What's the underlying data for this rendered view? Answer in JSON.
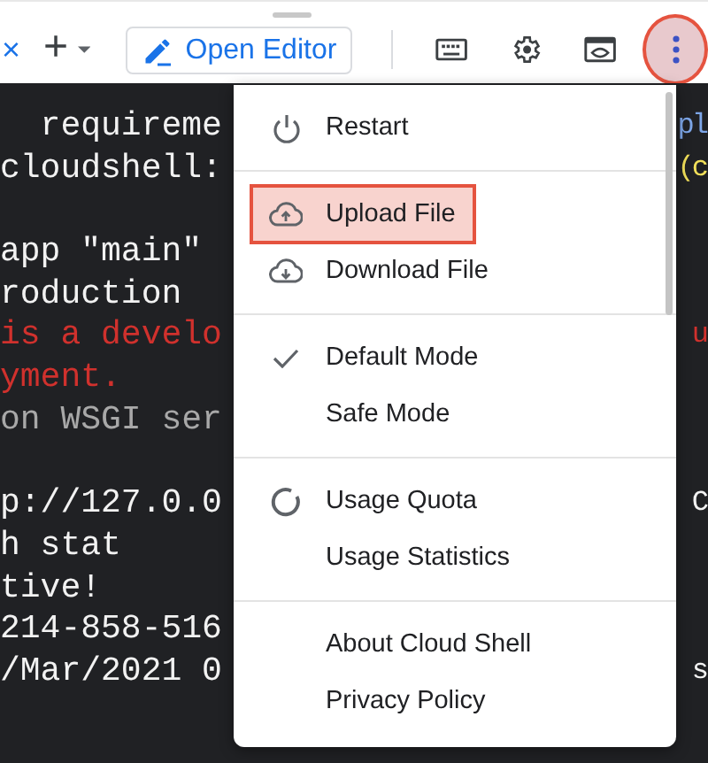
{
  "toolbar": {
    "tab_close": "×",
    "add": "+",
    "editor_button": "Open Editor",
    "more_highlighted": true
  },
  "terminal": [
    {
      "kind": "text",
      "text": "  requireme",
      "tail": {
        "text": "pl",
        "color": "#7da6e8"
      }
    },
    {
      "kind": "text",
      "text": "cloudshell:",
      "tail": {
        "text": "(c",
        "color": "#f2e05a"
      }
    },
    {
      "kind": "blank"
    },
    {
      "kind": "text",
      "text": "app \"main\""
    },
    {
      "kind": "text",
      "text": "roduction"
    },
    {
      "kind": "text",
      "text": "is a develo",
      "color": "#d0312d",
      "tail": {
        "text": "u",
        "color": "#d0312d"
      }
    },
    {
      "kind": "text",
      "text": "yment.",
      "color": "#d0312d"
    },
    {
      "kind": "text",
      "text": "on WSGI ser",
      "color": "#a8a8a8"
    },
    {
      "kind": "blank"
    },
    {
      "kind": "text",
      "text": "p://127.0.0",
      "tail": {
        "text": "C"
      }
    },
    {
      "kind": "text",
      "text": "h stat"
    },
    {
      "kind": "text",
      "text": "tive!"
    },
    {
      "kind": "text",
      "text": "214-858-516"
    },
    {
      "kind": "text",
      "text": "/Mar/2021 0",
      "tail": {
        "text": "s"
      }
    }
  ],
  "menu": {
    "sections": [
      [
        {
          "kind": "restart",
          "label": "Restart",
          "highlighted": false
        }
      ],
      [
        {
          "kind": "upload",
          "label": "Upload File",
          "highlighted": true
        },
        {
          "kind": "download",
          "label": "Download File",
          "highlighted": false
        }
      ],
      [
        {
          "kind": "mode",
          "label": "Default Mode",
          "checked": true,
          "highlighted": false
        },
        {
          "kind": "mode",
          "label": "Safe Mode",
          "checked": false,
          "highlighted": false
        }
      ],
      [
        {
          "kind": "quota",
          "label": "Usage Quota",
          "highlighted": false
        },
        {
          "kind": "plain",
          "label": "Usage Statistics",
          "highlighted": false
        }
      ],
      [
        {
          "kind": "plain",
          "label": "About Cloud Shell",
          "highlighted": false
        },
        {
          "kind": "plain",
          "label": "Privacy Policy",
          "highlighted": false
        }
      ]
    ]
  }
}
